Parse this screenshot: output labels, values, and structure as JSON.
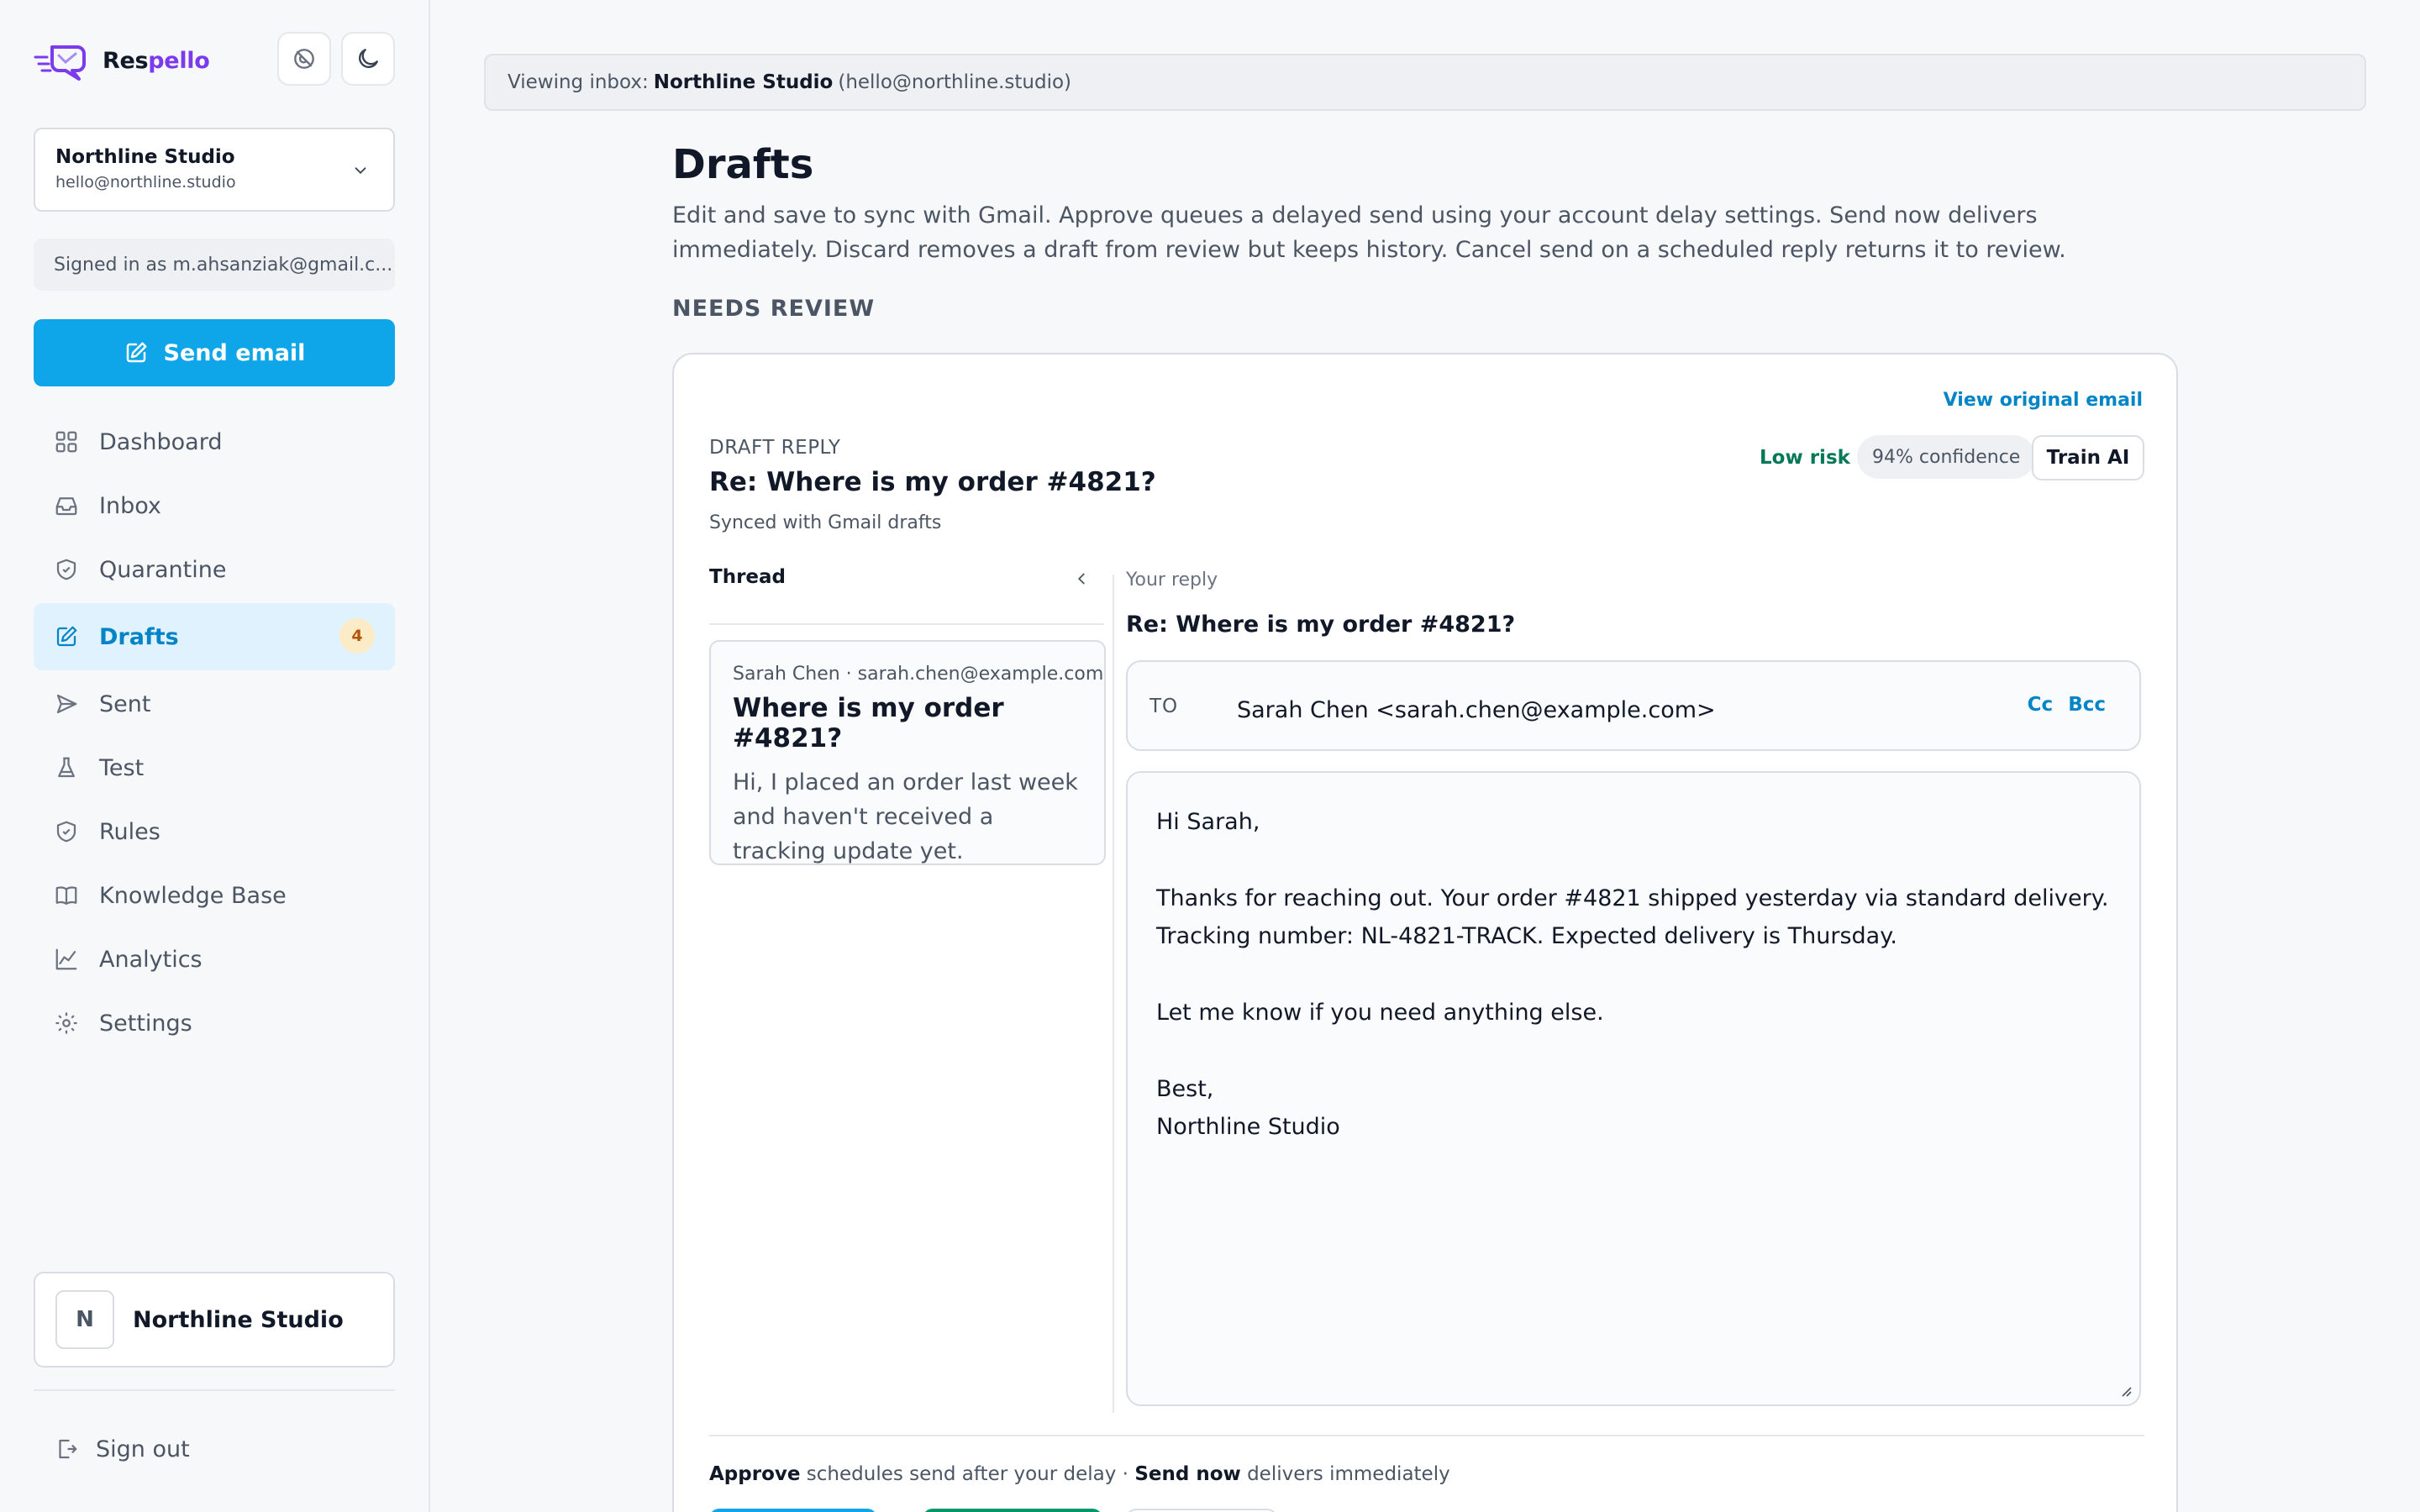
{
  "brand": {
    "name_prefix": "Res",
    "name_suffix": "pello"
  },
  "account": {
    "name": "Northline Studio",
    "email": "hello@northline.studio"
  },
  "signed_in": "Signed in as m.ahsanziak@gmail.c...",
  "send_email_label": "Send email",
  "nav": [
    {
      "label": "Dashboard",
      "icon": "grid-icon"
    },
    {
      "label": "Inbox",
      "icon": "inbox-icon"
    },
    {
      "label": "Quarantine",
      "icon": "shield-icon"
    },
    {
      "label": "Drafts",
      "icon": "edit-icon",
      "active": true,
      "badge": "4"
    },
    {
      "label": "Sent",
      "icon": "send-icon"
    },
    {
      "label": "Test",
      "icon": "flask-icon"
    },
    {
      "label": "Rules",
      "icon": "shield-check-icon"
    },
    {
      "label": "Knowledge Base",
      "icon": "book-icon"
    },
    {
      "label": "Analytics",
      "icon": "chart-line-icon"
    },
    {
      "label": "Settings",
      "icon": "gear-icon"
    }
  ],
  "org": {
    "initial": "N",
    "name": "Northline Studio"
  },
  "sign_out": "Sign out",
  "viewing": {
    "prefix": "Viewing inbox:",
    "name": "Northline Studio",
    "email": "(hello@northline.studio)"
  },
  "page": {
    "title": "Drafts",
    "description": "Edit and save to sync with Gmail. Approve queues a delayed send using your account delay settings. Send now delivers immediately. Discard removes a draft from review but keeps history. Cancel send on a scheduled reply returns it to review.",
    "section": "NEEDS REVIEW"
  },
  "draft": {
    "view_original": "View original email",
    "eyebrow": "DRAFT REPLY",
    "subject": "Re: Where is my order #4821?",
    "sync_status": "Synced with Gmail drafts",
    "risk": "Low risk",
    "confidence": "94% confidence",
    "train_label": "Train AI",
    "thread": {
      "heading": "Thread",
      "from": "Sarah Chen · sarah.chen@example.com",
      "subject": "Where is my order #4821?",
      "body": "Hi, I placed an order last week and haven't received a tracking update yet."
    },
    "reply": {
      "label": "Your reply",
      "subject": "Re: Where is my order #4821?",
      "to_label": "TO",
      "to_value": "Sarah Chen <sarah.chen@example.com>",
      "cc": "Cc",
      "bcc": "Bcc",
      "body": {
        "greeting": "Hi Sarah,",
        "para1": "Thanks for reaching out. Your order #4821 shipped yesterday via standard delivery. Tracking number: NL-4821-TRACK. Expected delivery is Thursday.",
        "para2": "Let me know if you need anything else.",
        "signoff": "Best,",
        "signature": "Northline Studio"
      }
    },
    "hint": {
      "approve": "Approve",
      "approve_text": "schedules send after your delay ·",
      "send_now": "Send now",
      "send_now_text": "delivers immediately"
    }
  },
  "colors": {
    "accent": "#0ea5e9",
    "brand_purple": "#7c3aed",
    "risk_green": "#047857",
    "badge_bg": "#fcebc7"
  }
}
